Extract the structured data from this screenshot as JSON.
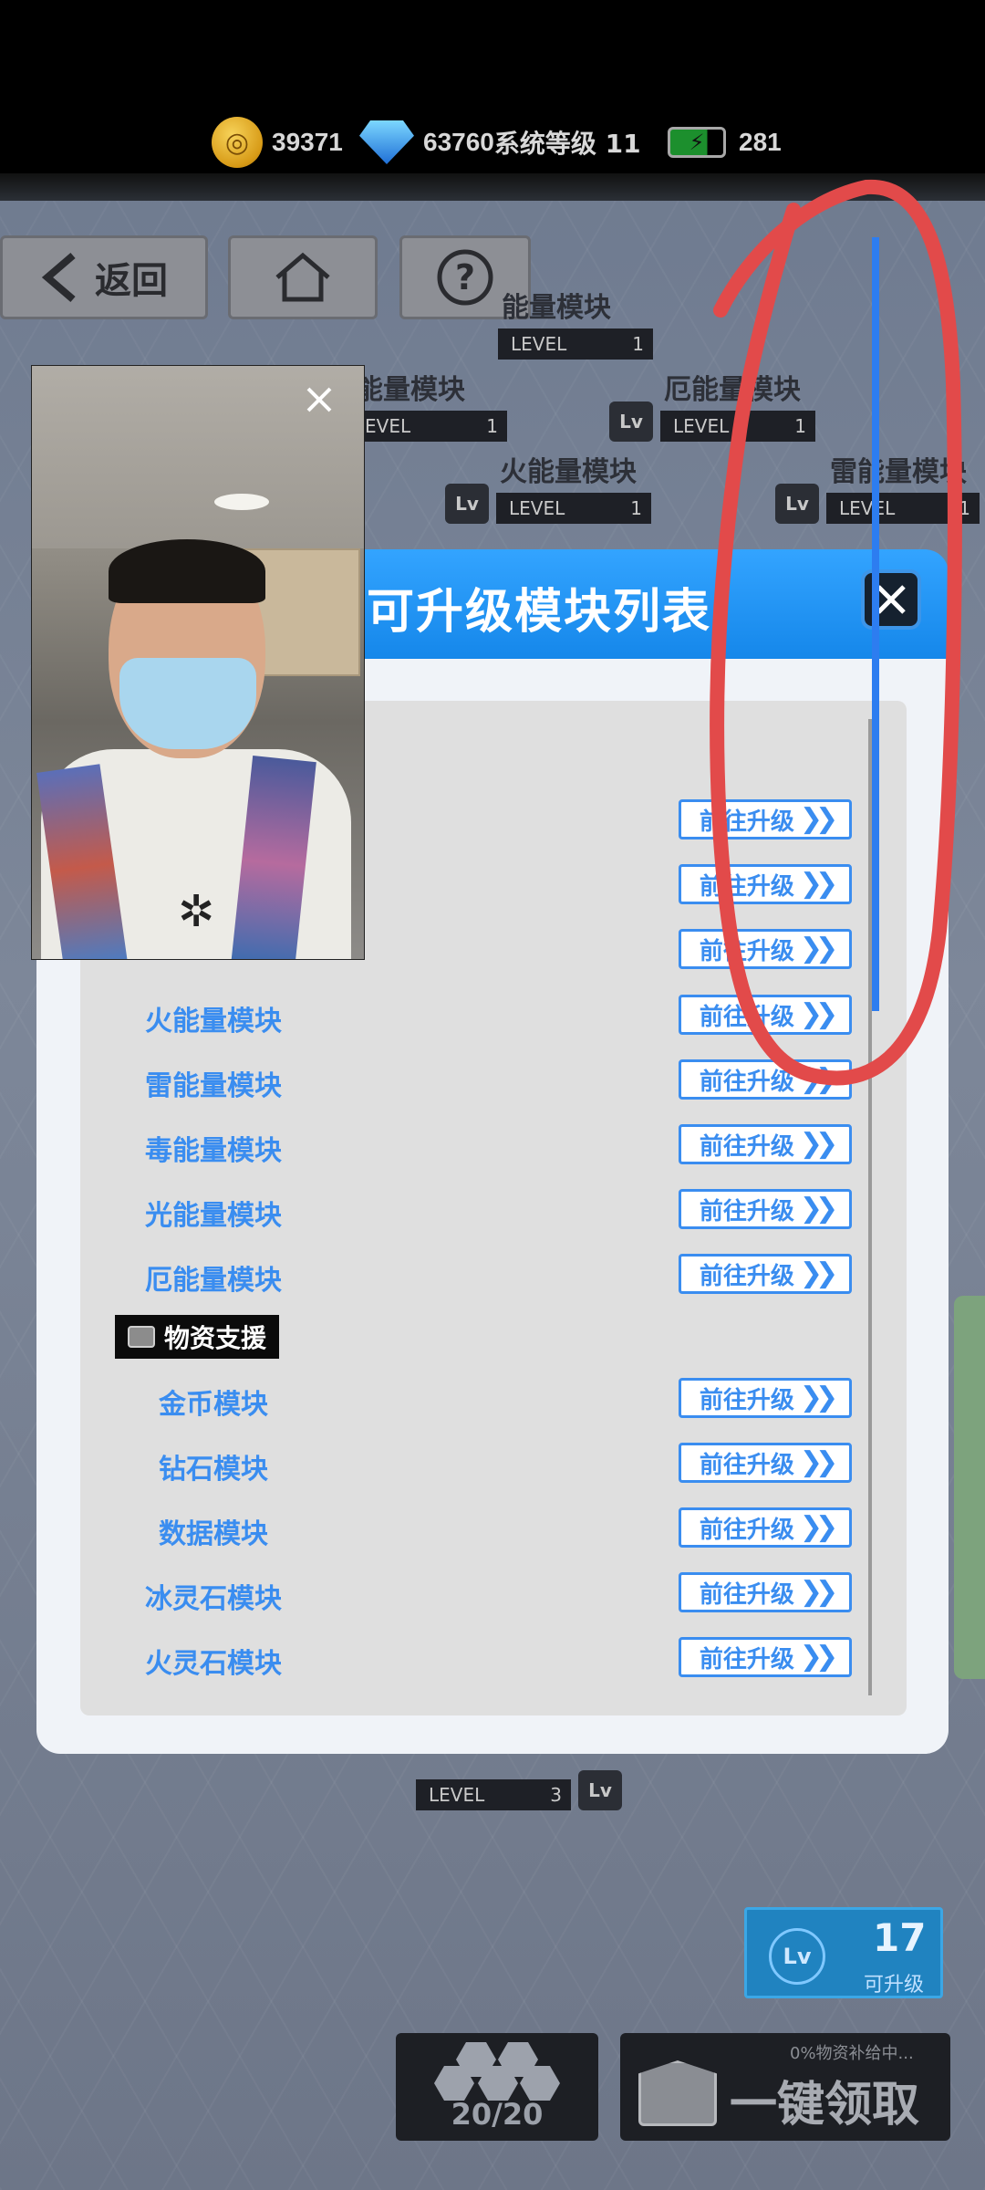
{
  "topbar": {
    "gold": "39371",
    "diamonds": "63760",
    "system_level": "系统等级 11",
    "energy": "281"
  },
  "nav": {
    "back_label": "返回"
  },
  "background_modules": [
    {
      "name": "能量模块",
      "level_text": "LEVEL",
      "level": "1"
    },
    {
      "name": "能量模块",
      "level_text": "EVEL",
      "level": "1"
    },
    {
      "name": "厄能量模块",
      "level_text": "LEVEL",
      "level": "1"
    },
    {
      "name": "火能量模块",
      "level_text": "LEVEL",
      "level": "1"
    },
    {
      "name": "雷能量模块",
      "level_text": "LEVEL",
      "level": "1"
    },
    {
      "name": "",
      "level_text": "LEVEL",
      "level": "3"
    }
  ],
  "modal": {
    "title": "可升级模块列表",
    "go_label": "前往升级",
    "energy_rows": [
      {
        "name": ""
      },
      {
        "name": ""
      },
      {
        "name": ""
      },
      {
        "name": "火能量模块"
      },
      {
        "name": "雷能量模块"
      },
      {
        "name": "毒能量模块"
      },
      {
        "name": "光能量模块"
      },
      {
        "name": "厄能量模块"
      }
    ],
    "section_label": "物资支援",
    "supply_rows": [
      {
        "name": "金币模块"
      },
      {
        "name": "钻石模块"
      },
      {
        "name": "数据模块"
      },
      {
        "name": "冰灵石模块"
      },
      {
        "name": "火灵石模块"
      }
    ]
  },
  "bottom": {
    "hex_count": "20/20",
    "claim_all": "一键领取",
    "supply_status": "0%物资补给中...",
    "upgradeable_count": "17",
    "upgradeable_label": "可升级",
    "lv_badge": "Lv"
  },
  "colors": {
    "accent_blue": "#1587ea",
    "link_blue": "#3a8df0",
    "annotation_red": "#e24a4a",
    "annotation_blue": "#2d7df0"
  }
}
